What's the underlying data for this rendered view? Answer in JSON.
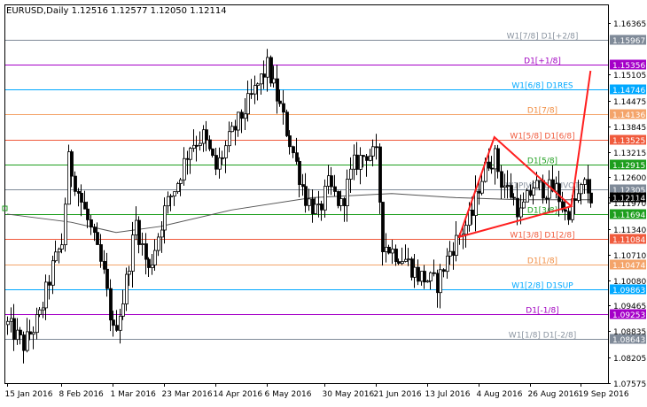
{
  "header": {
    "symbol": "EURUSD",
    "timeframe": "Daily",
    "ohlc": "1.12516 1.12577 1.12050 1.12114"
  },
  "chart_data": {
    "type": "candlestick",
    "title": "EURUSD,Daily  1.12516 1.12577 1.12050 1.12114",
    "grid": false,
    "ylim": [
      1.0757,
      1.168
    ],
    "y_ticks": [
      "1.16365",
      "1.15967",
      "1.15105",
      "1.14746",
      "1.14475",
      "1.14136",
      "1.13845",
      "1.13525",
      "1.13215",
      "1.12915",
      "1.12600",
      "1.12305",
      "1.12114",
      "1.11970",
      "1.11694",
      "1.11340",
      "1.11084",
      "1.10710",
      "1.10474",
      "1.10080",
      "1.09863",
      "1.09465",
      "1.09253",
      "1.08835",
      "1.08643",
      "1.08205",
      "1.07575"
    ],
    "x_ticks": [
      "15 Jan 2016",
      "8 Feb 2016",
      "1 Mar 2016",
      "23 Mar 2016",
      "14 Apr 2016",
      "6 May 2016",
      "30 May 2016",
      "21 Jun 2016",
      "13 Jul 2016",
      "4 Aug 2016",
      "26 Aug 2016",
      "19 Sep 2016"
    ],
    "x_tick_index": [
      0,
      17,
      33,
      49,
      65,
      81,
      99,
      115,
      131,
      147,
      163,
      179
    ],
    "current_price": "1.12114",
    "levels": [
      {
        "label": "W1[7/8] D1[+2/8]",
        "price": 1.15967,
        "tag": "1.15967",
        "color": "#7f8a98",
        "label_color": "#8a94a0"
      },
      {
        "label": "D1[+1/8]",
        "price": 1.15356,
        "tag": "1.15356",
        "color": "#a500c8",
        "label_color": "#a000c0"
      },
      {
        "label": "W1[6/8] D1RES",
        "price": 1.14746,
        "tag": "1.14746",
        "color": "#00a8ff",
        "label_color": "#00a8ff"
      },
      {
        "label": "D1[7/8]",
        "price": 1.14136,
        "tag": "1.14136",
        "color": "#f4a46a",
        "label_color": "#f08c40"
      },
      {
        "label": "W1[5/8] D1[6/8]",
        "price": 1.13525,
        "tag": "1.13525",
        "color": "#f05a3c",
        "label_color": "#f05a3c"
      },
      {
        "label": "D1[5/8]",
        "price": 1.12915,
        "tag": "1.12915",
        "color": "#1e9e1e",
        "label_color": "#1e9e1e"
      },
      {
        "label": "W1PIVOT D1PIVOT",
        "price": 1.12305,
        "tag": "1.12305",
        "color": "#7f8a98",
        "label_color": "#8a94a0"
      },
      {
        "label": "D1[3/8]",
        "price": 1.11694,
        "tag": "1.11694",
        "color": "#1e9e1e",
        "label_color": "#1e9e1e"
      },
      {
        "label": "W1[3/8] D1[2/8]",
        "price": 1.11084,
        "tag": "1.11084",
        "color": "#f05a3c",
        "label_color": "#f05a3c"
      },
      {
        "label": "D1[1/8]",
        "price": 1.10474,
        "tag": "1.10474",
        "color": "#f4a46a",
        "label_color": "#f08c40"
      },
      {
        "label": "W1[2/8] D1SUP",
        "price": 1.09863,
        "tag": "1.09863",
        "color": "#00a8ff",
        "label_color": "#00a8ff"
      },
      {
        "label": "D1[-1/8]",
        "price": 1.09253,
        "tag": "1.09253",
        "color": "#a500c8",
        "label_color": "#a000c0"
      },
      {
        "label": "W1[1/8] D1[-2/8]",
        "price": 1.08643,
        "tag": "1.08643",
        "color": "#7f8a98",
        "label_color": "#8a94a0"
      }
    ],
    "close_anchors": [
      [
        0,
        1.09
      ],
      [
        5,
        1.085
      ],
      [
        10,
        1.092
      ],
      [
        14,
        1.104
      ],
      [
        17,
        1.11
      ],
      [
        19,
        1.13
      ],
      [
        23,
        1.12
      ],
      [
        26,
        1.113
      ],
      [
        30,
        1.102
      ],
      [
        33,
        1.088
      ],
      [
        36,
        1.096
      ],
      [
        40,
        1.115
      ],
      [
        44,
        1.103
      ],
      [
        49,
        1.118
      ],
      [
        53,
        1.125
      ],
      [
        57,
        1.134
      ],
      [
        61,
        1.136
      ],
      [
        65,
        1.128
      ],
      [
        69,
        1.135
      ],
      [
        73,
        1.141
      ],
      [
        77,
        1.147
      ],
      [
        81,
        1.153
      ],
      [
        85,
        1.143
      ],
      [
        89,
        1.132
      ],
      [
        93,
        1.121
      ],
      [
        97,
        1.117
      ],
      [
        100,
        1.124
      ],
      [
        104,
        1.119
      ],
      [
        108,
        1.129
      ],
      [
        112,
        1.132
      ],
      [
        115,
        1.131
      ],
      [
        117,
        1.11
      ],
      [
        120,
        1.108
      ],
      [
        124,
        1.106
      ],
      [
        128,
        1.102
      ],
      [
        131,
        1.101
      ],
      [
        134,
        1.1
      ],
      [
        138,
        1.108
      ],
      [
        142,
        1.113
      ],
      [
        145,
        1.117
      ],
      [
        147,
        1.124
      ],
      [
        150,
        1.13
      ],
      [
        152,
        1.131
      ],
      [
        154,
        1.125
      ],
      [
        157,
        1.122
      ],
      [
        160,
        1.117
      ],
      [
        164,
        1.124
      ],
      [
        168,
        1.123
      ],
      [
        171,
        1.123
      ],
      [
        174,
        1.117
      ],
      [
        177,
        1.12
      ],
      [
        180,
        1.124
      ],
      [
        182,
        1.1211
      ]
    ],
    "moving_average": [
      [
        0,
        1.117
      ],
      [
        20,
        1.115
      ],
      [
        34,
        1.1125
      ],
      [
        48,
        1.114
      ],
      [
        70,
        1.118
      ],
      [
        95,
        1.121
      ],
      [
        120,
        1.122
      ],
      [
        140,
        1.121
      ],
      [
        160,
        1.1205
      ],
      [
        182,
        1.1205
      ]
    ],
    "triangle": [
      [
        152,
        1.1358
      ],
      [
        176,
        1.1189
      ],
      [
        141,
        1.1114
      ]
    ],
    "breakout_line": [
      [
        176,
        1.1189
      ],
      [
        182,
        1.152
      ]
    ]
  }
}
